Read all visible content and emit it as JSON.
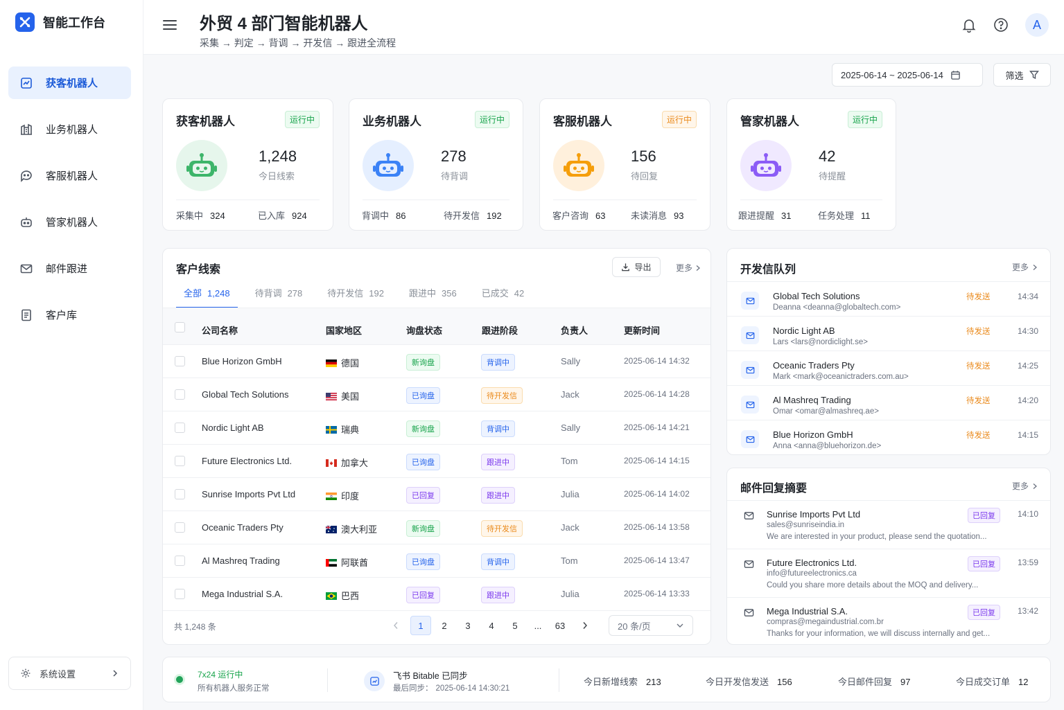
{
  "app": {
    "name": "智能工作台"
  },
  "sidebar": {
    "items": [
      {
        "label": "获客机器人",
        "icon": "chart-icon"
      },
      {
        "label": "业务机器人",
        "icon": "building-icon"
      },
      {
        "label": "客服机器人",
        "icon": "chat-icon"
      },
      {
        "label": "管家机器人",
        "icon": "robot-icon"
      },
      {
        "label": "邮件跟进",
        "icon": "mail-icon"
      },
      {
        "label": "客户库",
        "icon": "document-icon"
      }
    ],
    "settings_label": "系统设置"
  },
  "header": {
    "title": "外贸 4 部门智能机器人",
    "subtitle": "采集 → 判定 → 背调 → 开发信 → 跟进全流程",
    "avatar": "A"
  },
  "toolbar": {
    "date_range": "2025-06-14 ~ 2025-06-14",
    "filter_label": "筛选"
  },
  "bots": [
    {
      "name": "获客机器人",
      "status": "运行中",
      "value": "1,248",
      "label": "今日线索",
      "stat1_label": "采集中",
      "stat1_value": "324",
      "stat2_label": "已入库",
      "stat2_value": "924",
      "color": "#22a35a"
    },
    {
      "name": "业务机器人",
      "status": "运行中",
      "value": "278",
      "label": "待背调",
      "stat1_label": "背调中",
      "stat1_value": "86",
      "stat2_label": "待开发信",
      "stat2_value": "192",
      "color": "#3b82f6"
    },
    {
      "name": "客服机器人",
      "status": "运行中",
      "value": "156",
      "label": "待回复",
      "stat1_label": "客户咨询",
      "stat1_value": "63",
      "stat2_label": "未读消息",
      "stat2_value": "93",
      "color": "#f59e0b"
    },
    {
      "name": "管家机器人",
      "status": "运行中",
      "value": "42",
      "label": "待提醒",
      "stat1_label": "跟进提醒",
      "stat1_value": "31",
      "stat2_label": "任务处理",
      "stat2_value": "11",
      "color": "#8b5cf6"
    }
  ],
  "leads": {
    "title": "客户线索",
    "export_label": "导出",
    "more_label": "更多",
    "tabs": [
      {
        "label": "全部",
        "count": "1,248"
      },
      {
        "label": "待背调",
        "count": "278"
      },
      {
        "label": "待开发信",
        "count": "192"
      },
      {
        "label": "跟进中",
        "count": "356"
      },
      {
        "label": "已成交",
        "count": "42"
      }
    ],
    "columns": [
      "公司名称",
      "国家地区",
      "询盘状态",
      "跟进阶段",
      "负责人",
      "更新时间"
    ],
    "rows": [
      {
        "company": "Blue Horizon GmbH",
        "country": "德国",
        "flag": "de",
        "inquiry": "新询盘",
        "stage": "背调中",
        "owner": "Sally",
        "time": "2025-06-14 14:32"
      },
      {
        "company": "Global Tech Solutions",
        "country": "美国",
        "flag": "us",
        "inquiry": "已询盘",
        "stage": "待开发信",
        "owner": "Jack",
        "time": "2025-06-14 14:28"
      },
      {
        "company": "Nordic Light AB",
        "country": "瑞典",
        "flag": "se",
        "inquiry": "新询盘",
        "stage": "背调中",
        "owner": "Sally",
        "time": "2025-06-14 14:21"
      },
      {
        "company": "Future Electronics Ltd.",
        "country": "加拿大",
        "flag": "ca",
        "inquiry": "已询盘",
        "stage": "跟进中",
        "owner": "Tom",
        "time": "2025-06-14 14:15"
      },
      {
        "company": "Sunrise Imports Pvt Ltd",
        "country": "印度",
        "flag": "in",
        "inquiry": "已回复",
        "stage": "跟进中",
        "owner": "Julia",
        "time": "2025-06-14 14:02"
      },
      {
        "company": "Oceanic Traders Pty",
        "country": "澳大利亚",
        "flag": "au",
        "inquiry": "新询盘",
        "stage": "待开发信",
        "owner": "Jack",
        "time": "2025-06-14 13:58"
      },
      {
        "company": "Al Mashreq Trading",
        "country": "阿联酋",
        "flag": "ae",
        "inquiry": "已询盘",
        "stage": "背调中",
        "owner": "Tom",
        "time": "2025-06-14 13:47"
      },
      {
        "company": "Mega Industrial S.A.",
        "country": "巴西",
        "flag": "br",
        "inquiry": "已回复",
        "stage": "跟进中",
        "owner": "Julia",
        "time": "2025-06-14 13:33"
      }
    ],
    "total_label": "共 1,248 条",
    "pages": [
      "1",
      "2",
      "3",
      "4",
      "5",
      "...",
      "63"
    ],
    "per_page": "20 条/页"
  },
  "queue": {
    "title": "开发信队列",
    "more_label": "更多",
    "items": [
      {
        "name": "Global Tech Solutions",
        "email": "Deanna <deanna@globaltech.com>",
        "status": "待发送",
        "time": "14:34"
      },
      {
        "name": "Nordic Light AB",
        "email": "Lars <lars@nordiclight.se>",
        "status": "待发送",
        "time": "14:30"
      },
      {
        "name": "Oceanic Traders Pty",
        "email": "Mark <mark@oceanictraders.com.au>",
        "status": "待发送",
        "time": "14:25"
      },
      {
        "name": "Al Mashreq Trading",
        "email": "Omar <omar@almashreq.ae>",
        "status": "待发送",
        "time": "14:20"
      },
      {
        "name": "Blue Horizon GmbH",
        "email": "Anna <anna@bluehorizon.de>",
        "status": "待发送",
        "time": "14:15"
      }
    ]
  },
  "replies": {
    "title": "邮件回复摘要",
    "more_label": "更多",
    "items": [
      {
        "name": "Sunrise Imports Pvt Ltd",
        "email": "sales@sunriseindia.in",
        "msg": "We are interested in your product, please send the quotation...",
        "status": "已回复",
        "time": "14:10"
      },
      {
        "name": "Future Electronics Ltd.",
        "email": "info@futureelectronics.ca",
        "msg": "Could you share more details about the MOQ and delivery...",
        "status": "已回复",
        "time": "13:59"
      },
      {
        "name": "Mega Industrial S.A.",
        "email": "compras@megaindustrial.com.br",
        "msg": "Thanks for your information, we will discuss internally and get...",
        "status": "已回复",
        "time": "13:42"
      }
    ]
  },
  "footer": {
    "run_title": "7x24 运行中",
    "run_sub": "所有机器人服务正常",
    "sync_title": "飞书 Bitable 已同步",
    "sync_sub_label": "最后同步：",
    "sync_time": "2025-06-14 14:30:21",
    "stats": [
      {
        "label": "今日新增线索",
        "value": "213"
      },
      {
        "label": "今日开发信发送",
        "value": "156"
      },
      {
        "label": "今日邮件回复",
        "value": "97"
      },
      {
        "label": "今日成交订单",
        "value": "12"
      }
    ]
  }
}
